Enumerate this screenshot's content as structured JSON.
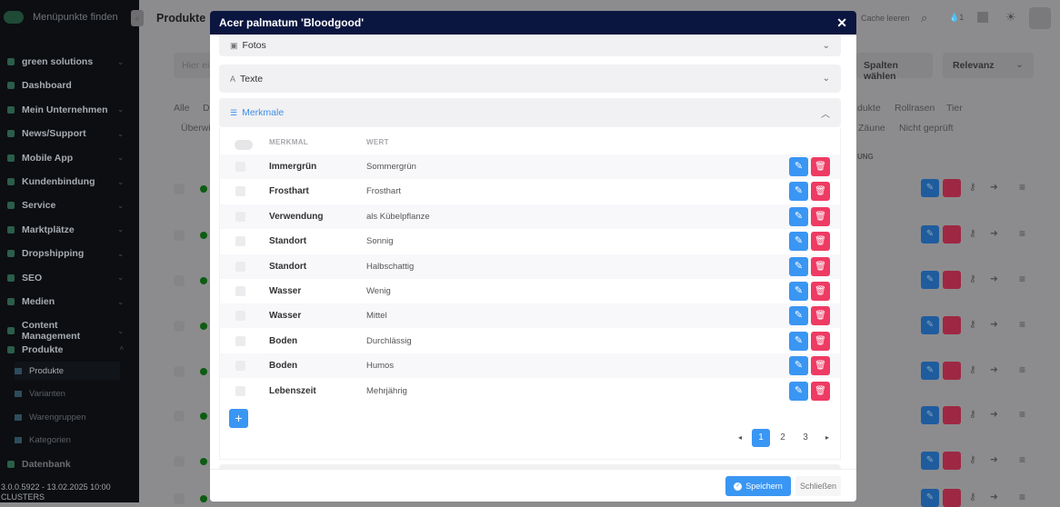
{
  "sidebar": {
    "search": "Menüpunkte finden",
    "items": [
      {
        "label": "green solutions"
      },
      {
        "label": "Dashboard"
      },
      {
        "label": "Mein Unternehmen"
      },
      {
        "label": "News/Support"
      },
      {
        "label": "Mobile App"
      },
      {
        "label": "Kundenbindung"
      },
      {
        "label": "Service"
      },
      {
        "label": "Marktplätze"
      },
      {
        "label": "Dropshipping"
      },
      {
        "label": "SEO"
      },
      {
        "label": "Medien"
      },
      {
        "label": "Content Management"
      },
      {
        "label": "Produkte"
      }
    ],
    "sub": [
      {
        "label": "Produkte"
      },
      {
        "label": "Varianten"
      },
      {
        "label": "Warengruppen"
      },
      {
        "label": "Kategorien"
      }
    ],
    "cut_item": "Datenbank",
    "version": "3.0.0.5922 - 13.02.2025 10:00",
    "footer2": "CLUSTERS"
  },
  "page": {
    "title": "Produkte",
    "search_placeholder": "Hier ein",
    "cache": "Cache leeren",
    "notif_count": "1",
    "columns": "Spalten wählen",
    "sort": "Relevanz",
    "tabs_left": [
      "Alle",
      "D"
    ],
    "tab_row2_left": "Überwi",
    "tabs_right": [
      "dukte",
      "Rollrasen",
      "Tier"
    ],
    "tabs_right2": [
      "Zäune",
      "Nicht geprüft"
    ],
    "col_fragment": "UNG"
  },
  "modal": {
    "title": "Acer palmatum 'Bloodgood'",
    "sections": [
      {
        "label": "Fotos",
        "icon": "image-icon"
      },
      {
        "label": "Texte",
        "icon": "text-icon"
      },
      {
        "label": "Merkmale",
        "icon": "sliders-icon"
      }
    ],
    "table": {
      "headers": [
        "MERKMAL",
        "WERT"
      ],
      "rows": [
        {
          "merkmal": "Immergrün",
          "wert": "Sommergrün"
        },
        {
          "merkmal": "Frosthart",
          "wert": "Frosthart"
        },
        {
          "merkmal": "Verwendung",
          "wert": "als Kübelpflanze"
        },
        {
          "merkmal": "Standort",
          "wert": "Sonnig"
        },
        {
          "merkmal": "Standort",
          "wert": "Halbschattig"
        },
        {
          "merkmal": "Wasser",
          "wert": "Wenig"
        },
        {
          "merkmal": "Wasser",
          "wert": "Mittel"
        },
        {
          "merkmal": "Boden",
          "wert": "Durchlässig"
        },
        {
          "merkmal": "Boden",
          "wert": "Humos"
        },
        {
          "merkmal": "Lebenszeit",
          "wert": "Mehrjährig"
        }
      ]
    },
    "pagination": {
      "pages": [
        "1",
        "2",
        "3"
      ],
      "current": "1"
    },
    "save": "Speichern",
    "close": "Schließen"
  },
  "colors": {
    "header": "#0b1640",
    "primary": "#3a96f3",
    "danger": "#ee3b63"
  }
}
